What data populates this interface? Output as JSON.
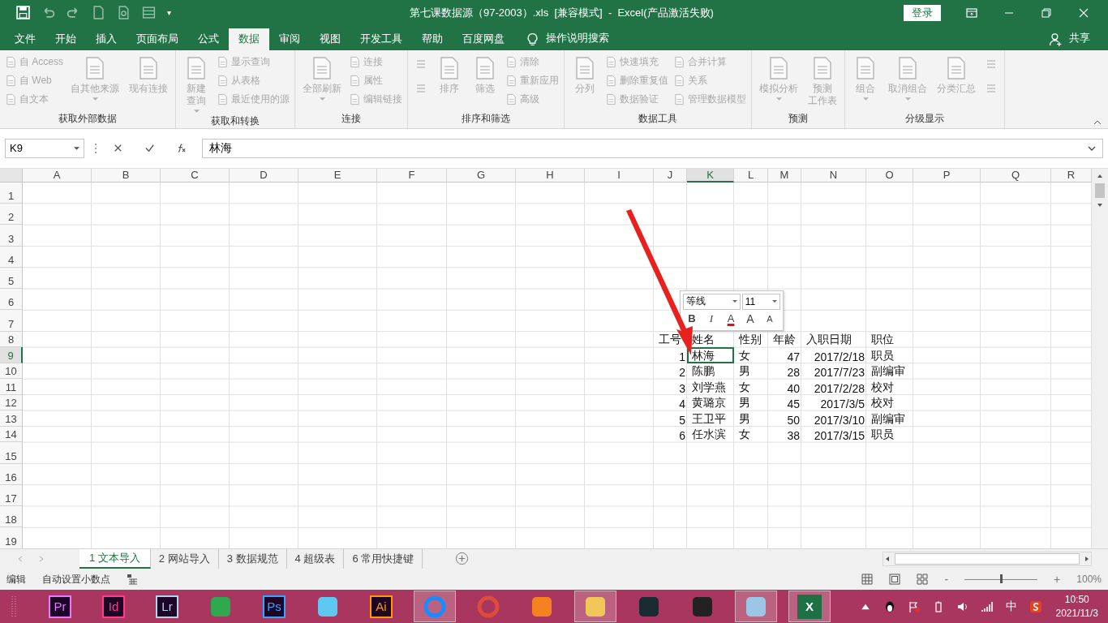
{
  "window": {
    "title": "第七课数据源（97-2003）.xls  [兼容模式]  -  Excel(产品激活失败)",
    "login": "登录",
    "qat_more": "▾"
  },
  "tabs": [
    {
      "label": "文件",
      "selected": false
    },
    {
      "label": "开始",
      "selected": false
    },
    {
      "label": "插入",
      "selected": false
    },
    {
      "label": "页面布局",
      "selected": false
    },
    {
      "label": "公式",
      "selected": false
    },
    {
      "label": "数据",
      "selected": true
    },
    {
      "label": "审阅",
      "selected": false
    },
    {
      "label": "视图",
      "selected": false
    },
    {
      "label": "开发工具",
      "selected": false
    },
    {
      "label": "帮助",
      "selected": false
    },
    {
      "label": "百度网盘",
      "selected": false
    }
  ],
  "tell_me": "操作说明搜索",
  "share": "共享",
  "ribbon": [
    {
      "label": "获取外部数据",
      "columns": [
        [
          {
            "kind": "small",
            "lines": [
              "自 Access"
            ],
            "disabled": true
          },
          {
            "kind": "small",
            "lines": [
              "自 Web"
            ],
            "disabled": true
          },
          {
            "kind": "small",
            "lines": [
              "自文本"
            ],
            "disabled": true
          }
        ],
        [
          {
            "kind": "large",
            "lines": [
              "自其他来源"
            ],
            "dropdown": true,
            "disabled": true
          }
        ],
        [
          {
            "kind": "large",
            "lines": [
              "现有连接"
            ],
            "dropdown": false,
            "disabled": true
          }
        ]
      ]
    },
    {
      "label": "获取和转换",
      "columns": [
        [
          {
            "kind": "large",
            "lines": [
              "新建",
              "查询"
            ],
            "dropdown": true,
            "disabled": true
          }
        ],
        [
          {
            "kind": "small",
            "lines": [
              "显示查询"
            ],
            "disabled": true
          },
          {
            "kind": "small",
            "lines": [
              "从表格"
            ],
            "disabled": true
          },
          {
            "kind": "small",
            "lines": [
              "最近使用的源"
            ],
            "disabled": true
          }
        ]
      ]
    },
    {
      "label": "连接",
      "columns": [
        [
          {
            "kind": "large",
            "lines": [
              "全部刷新"
            ],
            "dropdown": true,
            "disabled": true
          }
        ],
        [
          {
            "kind": "small",
            "lines": [
              "连接"
            ],
            "disabled": true
          },
          {
            "kind": "small",
            "lines": [
              "属性"
            ],
            "disabled": true
          },
          {
            "kind": "small",
            "lines": [
              "编辑链接"
            ],
            "disabled": true
          }
        ]
      ]
    },
    {
      "label": "排序和筛选",
      "columns": [
        [
          {
            "kind": "icon",
            "disabled": true
          },
          {
            "kind": "icon",
            "disabled": true
          }
        ],
        [
          {
            "kind": "large",
            "lines": [
              "排序"
            ],
            "dropdown": false,
            "disabled": true
          }
        ],
        [
          {
            "kind": "large",
            "lines": [
              "筛选"
            ],
            "dropdown": false,
            "disabled": true
          }
        ],
        [
          {
            "kind": "small",
            "lines": [
              "清除"
            ],
            "disabled": true
          },
          {
            "kind": "small",
            "lines": [
              "重新应用"
            ],
            "disabled": true
          },
          {
            "kind": "small",
            "lines": [
              "高级"
            ],
            "disabled": true
          }
        ]
      ]
    },
    {
      "label": "数据工具",
      "columns": [
        [
          {
            "kind": "large",
            "lines": [
              "分列"
            ],
            "dropdown": false,
            "disabled": true
          }
        ],
        [
          {
            "kind": "small",
            "lines": [
              "快速填充"
            ],
            "disabled": true
          },
          {
            "kind": "small",
            "lines": [
              "删除重复值"
            ],
            "disabled": true
          },
          {
            "kind": "small",
            "lines": [
              "数据验证"
            ],
            "disabled": true
          }
        ],
        [
          {
            "kind": "small",
            "lines": [
              "合并计算"
            ],
            "disabled": true
          },
          {
            "kind": "small",
            "lines": [
              "关系"
            ],
            "disabled": true
          },
          {
            "kind": "small",
            "lines": [
              "管理数据模型"
            ],
            "disabled": true
          }
        ]
      ]
    },
    {
      "label": "预测",
      "columns": [
        [
          {
            "kind": "large",
            "lines": [
              "模拟分析"
            ],
            "dropdown": true,
            "disabled": true
          }
        ],
        [
          {
            "kind": "large",
            "lines": [
              "预测",
              "工作表"
            ],
            "dropdown": false,
            "disabled": true
          }
        ]
      ]
    },
    {
      "label": "分级显示",
      "columns": [
        [
          {
            "kind": "large",
            "lines": [
              "组合"
            ],
            "dropdown": true,
            "disabled": true
          }
        ],
        [
          {
            "kind": "large",
            "lines": [
              "取消组合"
            ],
            "dropdown": true,
            "disabled": true
          }
        ],
        [
          {
            "kind": "large",
            "lines": [
              "分类汇总"
            ],
            "dropdown": false,
            "disabled": true
          }
        ],
        [
          {
            "kind": "icon",
            "disabled": true
          },
          {
            "kind": "icon",
            "disabled": true
          }
        ]
      ]
    }
  ],
  "formula_bar": {
    "name_box": "K9",
    "formula": "林海"
  },
  "column_headers": [
    "A",
    "B",
    "C",
    "D",
    "E",
    "F",
    "G",
    "H",
    "I",
    "J",
    "K",
    "L",
    "M",
    "N",
    "O",
    "P",
    "Q",
    "R"
  ],
  "row_headers": [
    "1",
    "2",
    "3",
    "4",
    "5",
    "6",
    "7",
    "8",
    "9",
    "10",
    "11",
    "12",
    "13",
    "14",
    "15",
    "16",
    "17",
    "18",
    "19"
  ],
  "table": {
    "rows": [
      [
        {
          "text": "工号",
          "selected": false
        },
        {
          "text": "姓名",
          "selected": false
        },
        {
          "text": "性别",
          "selected": false
        },
        {
          "text": "年龄",
          "selected": false
        },
        {
          "text": "入职日期",
          "selected": false
        },
        {
          "text": "职位",
          "selected": false
        }
      ],
      [
        {
          "text": "1",
          "kind": "number",
          "selected": false
        },
        {
          "text": "林海",
          "kind": "text",
          "selected": true
        },
        {
          "text": "女",
          "kind": "text",
          "selected": false
        },
        {
          "text": "47",
          "kind": "number",
          "selected": false
        },
        {
          "text": "2017/2/18",
          "kind": "number",
          "selected": false
        },
        {
          "text": "职员",
          "kind": "text",
          "selected": false
        }
      ],
      [
        {
          "text": "2",
          "kind": "number",
          "selected": false
        },
        {
          "text": "陈鹏",
          "kind": "text",
          "selected": false
        },
        {
          "text": "男",
          "kind": "text",
          "selected": false
        },
        {
          "text": "28",
          "kind": "number",
          "selected": false
        },
        {
          "text": "2017/7/23",
          "kind": "number",
          "selected": false
        },
        {
          "text": "副编审",
          "kind": "text",
          "selected": false
        }
      ],
      [
        {
          "text": "3",
          "kind": "number",
          "selected": false
        },
        {
          "text": "刘学燕",
          "kind": "text",
          "selected": false
        },
        {
          "text": "女",
          "kind": "text",
          "selected": false
        },
        {
          "text": "40",
          "kind": "number",
          "selected": false
        },
        {
          "text": "2017/2/28",
          "kind": "number",
          "selected": false
        },
        {
          "text": "校对",
          "kind": "text",
          "selected": false
        }
      ],
      [
        {
          "text": "4",
          "kind": "number",
          "selected": false
        },
        {
          "text": "黄璐京",
          "kind": "text",
          "selected": false
        },
        {
          "text": "男",
          "kind": "text",
          "selected": false
        },
        {
          "text": "45",
          "kind": "number",
          "selected": false
        },
        {
          "text": "2017/3/5",
          "kind": "number",
          "selected": false
        },
        {
          "text": "校对",
          "kind": "text",
          "selected": false
        }
      ],
      [
        {
          "text": "5",
          "kind": "number",
          "selected": false
        },
        {
          "text": "王卫平",
          "kind": "text",
          "selected": false
        },
        {
          "text": "男",
          "kind": "text",
          "selected": false
        },
        {
          "text": "50",
          "kind": "number",
          "selected": false
        },
        {
          "text": "2017/3/10",
          "kind": "number",
          "selected": false
        },
        {
          "text": "副编审",
          "kind": "text",
          "selected": false
        }
      ],
      [
        {
          "text": "6",
          "kind": "number",
          "selected": false
        },
        {
          "text": "任水滨",
          "kind": "text",
          "selected": false
        },
        {
          "text": "女",
          "kind": "text",
          "selected": false
        },
        {
          "text": "38",
          "kind": "number",
          "selected": false
        },
        {
          "text": "2017/3/15",
          "kind": "number",
          "selected": false
        },
        {
          "text": "职员",
          "kind": "text",
          "selected": false
        }
      ]
    ]
  },
  "mini_toolbar": {
    "font": "等线",
    "size": "11",
    "buttons": [
      {
        "kind": "bold",
        "label": "B"
      },
      {
        "kind": "italic",
        "label": "I"
      },
      {
        "kind": "color",
        "label": "A"
      },
      {
        "kind": "grow",
        "label": "A"
      },
      {
        "kind": "shrink",
        "label": "A"
      }
    ]
  },
  "sheet_tabs": [
    {
      "label": "1 文本导入",
      "selected": true
    },
    {
      "label": "2 网站导入",
      "selected": false
    },
    {
      "label": "3 数据规范",
      "selected": false
    },
    {
      "label": "4 超级表",
      "selected": false
    },
    {
      "label": "6 常用快捷键",
      "selected": false
    }
  ],
  "status_bar": {
    "mode": "编辑",
    "fixed_decimal": "自动设置小数点",
    "zoom_out": "-",
    "zoom_in": "+",
    "zoom": "100%",
    "zoom_slider": {
      "level": 0.5
    }
  },
  "taskbar": {
    "apps": [
      {
        "kind": "badge",
        "label": "Pr",
        "color": "#ea77ff",
        "selected": false
      },
      {
        "kind": "badge",
        "label": "Id",
        "color": "#ff3d8b",
        "selected": false
      },
      {
        "kind": "badge",
        "label": "Lr",
        "color": "#add5ec",
        "selected": false
      },
      {
        "kind": "app",
        "color": "#2fa84f",
        "selected": false
      },
      {
        "kind": "badge",
        "label": "Ps",
        "color": "#31a8ff",
        "selected": false
      },
      {
        "kind": "app",
        "color": "#5ec8f0",
        "selected": false
      },
      {
        "kind": "badge",
        "label": "Ai",
        "color": "#ff9a00",
        "selected": false
      },
      {
        "kind": "ring",
        "color": "#1a8cff",
        "selected": true
      },
      {
        "kind": "ring",
        "color": "#dd4b39",
        "selected": false
      },
      {
        "kind": "app",
        "color": "#f58220",
        "selected": false
      },
      {
        "kind": "app",
        "color": "#f0c85a",
        "selected": true
      },
      {
        "kind": "app",
        "color": "#1b2b33",
        "selected": false
      },
      {
        "kind": "app",
        "color": "#222222",
        "selected": false
      },
      {
        "kind": "app",
        "color": "#9cc6e6",
        "selected": true
      },
      {
        "kind": "letter",
        "label": "X",
        "color": "#1e7145",
        "selected": true
      }
    ],
    "ime": "中",
    "time": "10:50",
    "date": "2021/11/3"
  }
}
